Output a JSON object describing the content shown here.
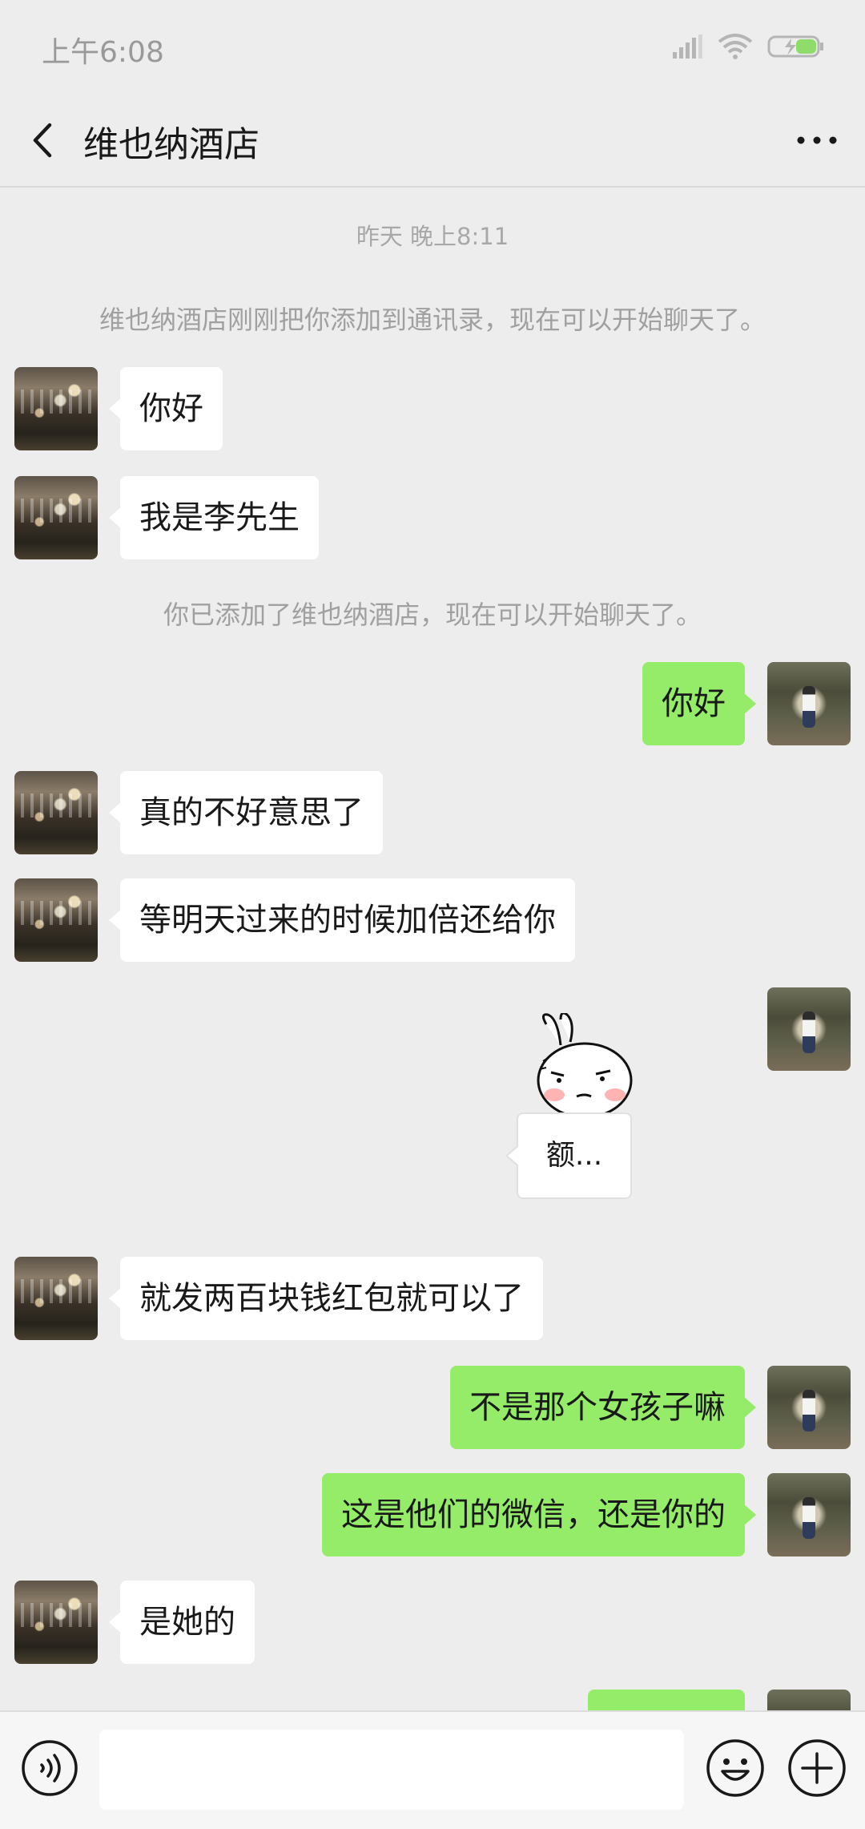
{
  "status_bar": {
    "time": "上午6:08",
    "icons": [
      "signal-icon",
      "wifi-icon",
      "battery-charging-icon"
    ]
  },
  "header": {
    "back_icon": "chevron-left-icon",
    "title": "维也纳酒店",
    "more_icon": "more-dots-icon"
  },
  "chat": {
    "timestamp": "昨天 晚上8:11",
    "system_messages": [
      "维也纳酒店刚刚把你添加到通讯录，现在可以开始聊天了。",
      "你已添加了维也纳酒店，现在可以开始聊天了。"
    ],
    "messages": [
      {
        "side": "left",
        "text": "你好"
      },
      {
        "side": "left",
        "text": "我是李先生"
      },
      {
        "side": "right",
        "text": "你好"
      },
      {
        "side": "left",
        "text": "真的不好意思了"
      },
      {
        "side": "left",
        "text": "等明天过来的时候加倍还给你"
      },
      {
        "side": "right",
        "type": "sticker",
        "text": "额..."
      },
      {
        "side": "left",
        "text": "就发两百块钱红包就可以了"
      },
      {
        "side": "right",
        "text": "不是那个女孩子嘛"
      },
      {
        "side": "right",
        "text": "这是他们的微信，还是你的"
      },
      {
        "side": "left",
        "text": "是她的"
      }
    ]
  },
  "input_bar": {
    "voice_icon": "voice-icon",
    "input_value": "",
    "emoji_icon": "emoji-icon",
    "plus_icon": "plus-circle-icon"
  },
  "colors": {
    "background": "#ededed",
    "my_bubble": "#95ec69",
    "their_bubble": "#ffffff",
    "system_text": "#a0a0a0"
  }
}
